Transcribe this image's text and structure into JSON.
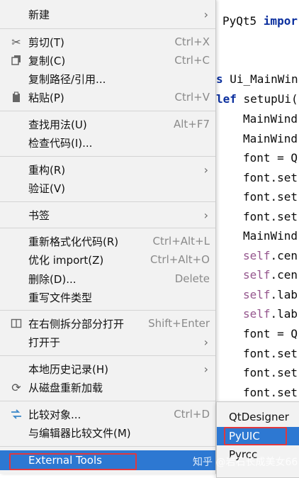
{
  "editor": {
    "lines": [
      {
        "pre": "",
        "kw": "",
        "text": "PyQt5 ",
        "kw2": "impor"
      },
      {
        "pre": "s",
        "kw": "",
        "text": " Ui_MainWin",
        "kw2": ""
      },
      {
        "pre": "",
        "kw": "lef",
        "text": " setupUi(",
        "kw2": ""
      },
      {
        "pre": "",
        "kw": "",
        "text": "MainWind",
        "kw2": ""
      },
      {
        "pre": "",
        "kw": "",
        "text": "MainWind",
        "kw2": ""
      },
      {
        "pre": "",
        "kw": "",
        "text": "font = Q",
        "kw2": ""
      },
      {
        "pre": "",
        "kw": "",
        "text": "font.set",
        "kw2": ""
      },
      {
        "pre": "",
        "kw": "",
        "text": "font.set",
        "kw2": ""
      },
      {
        "pre": "",
        "kw": "",
        "text": "font.set",
        "kw2": ""
      },
      {
        "pre": "",
        "kw": "",
        "text": "MainWind",
        "kw2": ""
      },
      {
        "pre": "",
        "kw": "self",
        "text": ".cen",
        "kw2": ""
      },
      {
        "pre": "",
        "kw": "self",
        "text": ".cen",
        "kw2": ""
      },
      {
        "pre": "",
        "kw": "self",
        "text": ".lab",
        "kw2": ""
      },
      {
        "pre": "",
        "kw": "self",
        "text": ".lab",
        "kw2": ""
      },
      {
        "pre": "",
        "kw": "",
        "text": "font = Q",
        "kw2": ""
      },
      {
        "pre": "",
        "kw": "",
        "text": "font.set",
        "kw2": ""
      },
      {
        "pre": "",
        "kw": "",
        "text": "font.set",
        "kw2": ""
      },
      {
        "pre": "",
        "kw": "",
        "text": "font.set",
        "kw2": ""
      }
    ]
  },
  "menu": {
    "new": "新建",
    "cut": "剪切(T)",
    "cut_shortcut": "Ctrl+X",
    "copy": "复制(C)",
    "copy_shortcut": "Ctrl+C",
    "copy_path": "复制路径/引用...",
    "paste": "粘贴(P)",
    "paste_shortcut": "Ctrl+V",
    "find_usages": "查找用法(U)",
    "find_usages_shortcut": "Alt+F7",
    "inspect_code": "检查代码(I)...",
    "refactor": "重构(R)",
    "verify": "验证(V)",
    "bookmarks": "书签",
    "reformat": "重新格式化代码(R)",
    "reformat_shortcut": "Ctrl+Alt+L",
    "optimize_imports": "优化 import(Z)",
    "optimize_imports_shortcut": "Ctrl+Alt+O",
    "delete": "删除(D)...",
    "delete_shortcut": "Delete",
    "override_file_type": "重写文件类型",
    "open_split_right": "在右侧拆分部分打开",
    "open_split_right_shortcut": "Shift+Enter",
    "open_in": "打开于",
    "local_history": "本地历史记录(H)",
    "reload_from_disk": "从磁盘重新加载",
    "compare_with": "比较对象...",
    "compare_with_shortcut": "Ctrl+D",
    "compare_with_editor": "与编辑器比较文件(M)",
    "external_tools": "External Tools"
  },
  "submenu": {
    "qtdesigner": "QtDesigner",
    "pyuic": "PyUIC",
    "pyrcc": "Pyrcc"
  },
  "watermark": "知乎 @岩石长成美女66",
  "colors": {
    "highlight": "#2d78d2",
    "annotation_box": "#e0383e",
    "keyword": "#0b2f9e",
    "self": "#94558d"
  }
}
